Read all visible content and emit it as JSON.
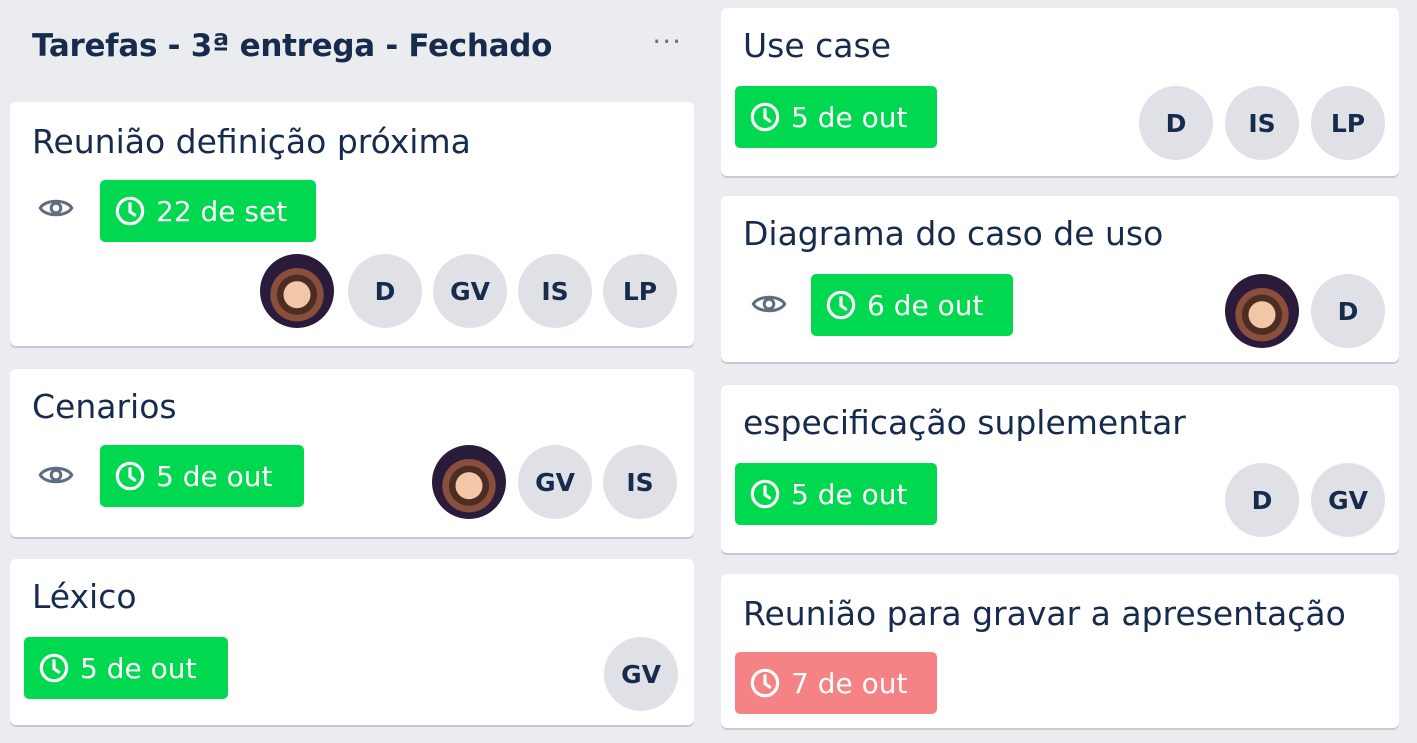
{
  "list": {
    "title": "Tarefas - 3ª entrega - Fechado",
    "menu_icon": "more-horizontal-icon"
  },
  "colors": {
    "board_background": "#ebecf0",
    "due_green": "#00d84f",
    "due_red": "#f58385",
    "avatar_background": "#dfe1e6",
    "text": "#172b4d"
  },
  "cards": {
    "c0": {
      "title": "Reunião definição próxima",
      "watching": true,
      "due": "22 de set",
      "due_status": "green",
      "members": [
        "photo",
        "D",
        "GV",
        "IS",
        "LP"
      ]
    },
    "c1": {
      "title": "Cenarios",
      "watching": true,
      "due": "5 de out",
      "due_status": "green",
      "members": [
        "photo",
        "GV",
        "IS"
      ]
    },
    "c2": {
      "title": "Léxico",
      "watching": false,
      "due": "5 de out",
      "due_status": "green",
      "members": [
        "GV"
      ]
    },
    "c3": {
      "title": "Use case",
      "watching": false,
      "due": "5 de out",
      "due_status": "green",
      "members": [
        "D",
        "IS",
        "LP"
      ]
    },
    "c4": {
      "title": "Diagrama do caso de uso",
      "watching": true,
      "due": "6 de out",
      "due_status": "green",
      "members": [
        "photo",
        "D"
      ]
    },
    "c5": {
      "title": "especificação suplementar",
      "watching": false,
      "due": "5 de out",
      "due_status": "green",
      "members": [
        "D",
        "GV"
      ]
    },
    "c6": {
      "title": "Reunião para gravar a apresentação",
      "watching": false,
      "due": "7 de out",
      "due_status": "red",
      "members": []
    }
  }
}
